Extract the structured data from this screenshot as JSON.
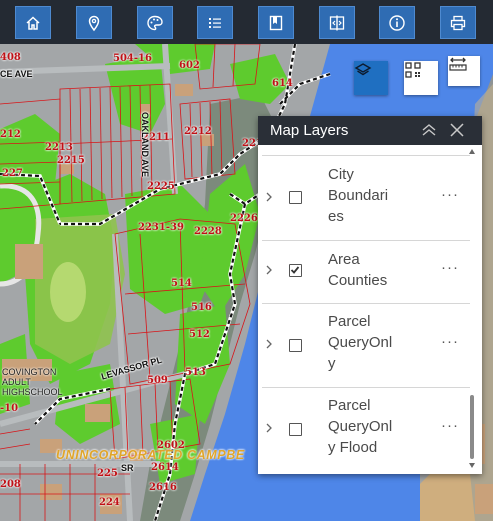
{
  "toolbar": {
    "buttons": [
      {
        "name": "home-button",
        "icon": "home-icon"
      },
      {
        "name": "locate-button",
        "icon": "location-pin-icon"
      },
      {
        "name": "basemap-button",
        "icon": "palette-icon"
      },
      {
        "name": "legend-button",
        "icon": "list-icon"
      },
      {
        "name": "bookmark-button",
        "icon": "bookmark-icon"
      },
      {
        "name": "swipe-button",
        "icon": "compare-icon"
      },
      {
        "name": "about-button",
        "icon": "info-icon"
      },
      {
        "name": "print-button",
        "icon": "printer-icon"
      }
    ]
  },
  "map": {
    "widgets": [
      {
        "name": "layer-list-button",
        "icon": "layers-icon"
      },
      {
        "name": "qr-code-button",
        "icon": "qr-code-icon"
      },
      {
        "name": "measure-button",
        "icon": "ruler-icon"
      }
    ],
    "parcel_labels": [
      "408",
      "504-16",
      "602",
      "212",
      "2211",
      "2212",
      "2213",
      "2215",
      "227",
      "2225",
      "2231-39",
      "2228",
      "2226",
      "514",
      "516",
      "512",
      "513",
      "509",
      "-10",
      "2602",
      "2614",
      "225",
      "2616",
      "208",
      "224",
      "614",
      "221"
    ],
    "streets": [
      "CE AVE",
      "OAKLAND AVE",
      "LEVASSOR PL",
      "SR"
    ],
    "places": {
      "school": [
        "COVINGTON",
        "ADULT",
        "HIGHSCHOOL"
      ],
      "area": "UNINCORPORATED CAMPBE"
    }
  },
  "colors": {
    "toolbar": "#242a33",
    "toolbar_button": "#2f6cb3",
    "layer_button": "#1f6fc1",
    "river": "#4e86e8",
    "vegetation": "#5ecb2e",
    "parcel_line": "#d81418"
  },
  "panel": {
    "title": "Map Layers",
    "layers": [
      {
        "name": "City Boundaries",
        "lines": [
          "City",
          "Boundari",
          "es"
        ],
        "checked": false
      },
      {
        "name": "Area Counties",
        "lines": [
          "Area",
          "Counties"
        ],
        "checked": true
      },
      {
        "name": "Parcel QueryOnly",
        "lines": [
          "Parcel",
          "QueryOnl",
          "y"
        ],
        "checked": false
      },
      {
        "name": "Parcel QueryOnly Flood",
        "lines": [
          "Parcel",
          "QueryOnl",
          "y Flood"
        ],
        "checked": false
      }
    ],
    "more_label": "···"
  }
}
